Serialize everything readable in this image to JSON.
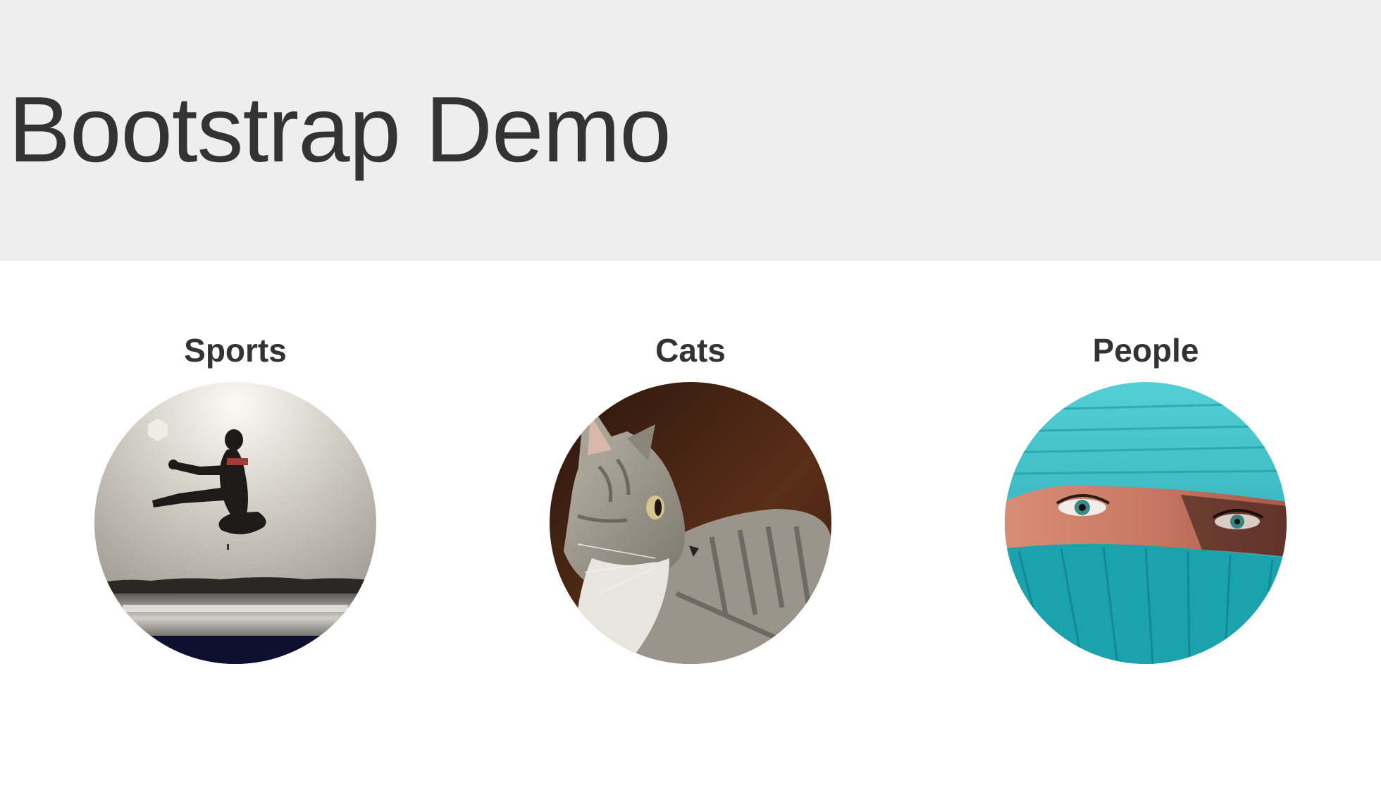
{
  "header": {
    "title": "Bootstrap Demo",
    "background": "#eeeeee"
  },
  "categories": [
    {
      "title": "Sports",
      "image": "silhouette-jump-kick-image"
    },
    {
      "title": "Cats",
      "image": "tabby-cat-profile-image"
    },
    {
      "title": "People",
      "image": "turquoise-veiled-face-image"
    }
  ],
  "colors": {
    "text": "#333333",
    "accent_turquoise": "#2bb6c0"
  }
}
